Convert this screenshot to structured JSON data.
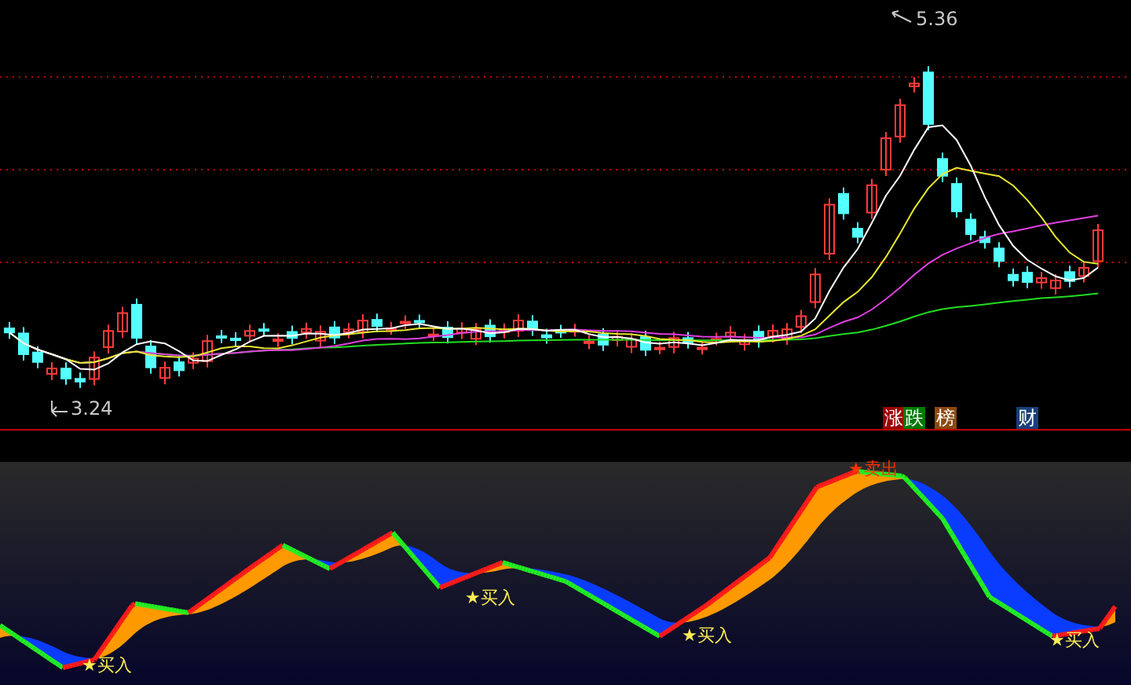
{
  "price_chart": {
    "high_label": "5.36",
    "low_label": "3.24"
  },
  "tags": [
    {
      "text": "涨",
      "color": "#990000"
    },
    {
      "text": "跌",
      "color": "#007a00"
    },
    {
      "text": "榜",
      "color": "#8a4a10"
    },
    {
      "text": "财",
      "color": "#1a3f7a"
    }
  ],
  "signals": [
    {
      "kind": "buy",
      "label": "★买入"
    },
    {
      "kind": "buy",
      "label": "★买入"
    },
    {
      "kind": "buy",
      "label": "★买入"
    },
    {
      "kind": "sell",
      "label": "★卖出"
    },
    {
      "kind": "buy",
      "label": "★买入"
    }
  ]
}
